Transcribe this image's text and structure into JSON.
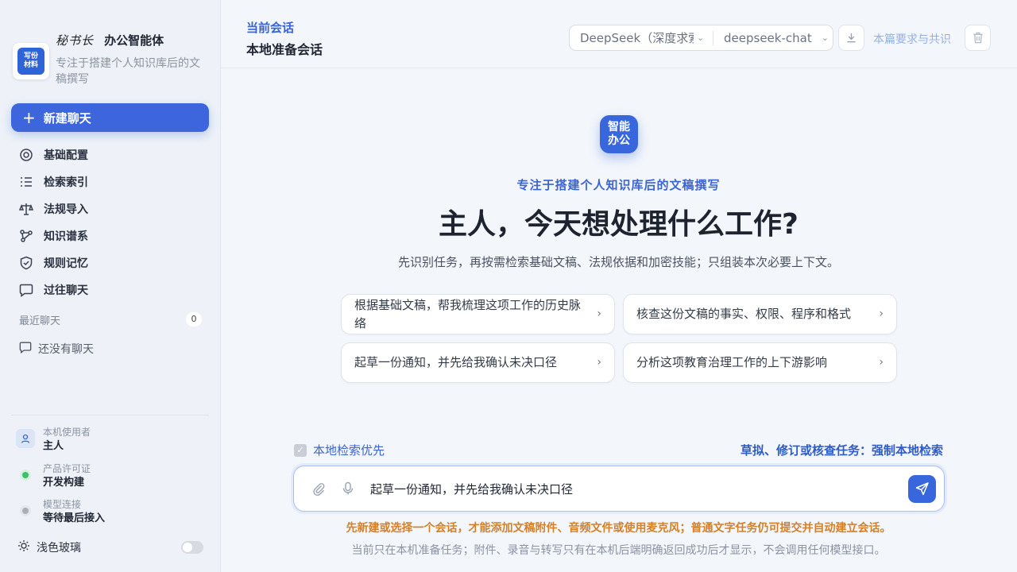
{
  "sidebar": {
    "brand": {
      "signature": "秘书长",
      "name": "办公智能体",
      "logo_text": "写份材料",
      "description": "专注于搭建个人知识库后的文稿撰写"
    },
    "new_chat_label": "新建聊天",
    "nav": [
      {
        "label": "基础配置",
        "icon": "gear-icon"
      },
      {
        "label": "检索索引",
        "icon": "list-icon"
      },
      {
        "label": "法规导入",
        "icon": "scale-icon"
      },
      {
        "label": "知识谱系",
        "icon": "graph-icon"
      },
      {
        "label": "规则记忆",
        "icon": "shield-icon"
      },
      {
        "label": "过往聊天",
        "icon": "chat-icon"
      }
    ],
    "recent": {
      "title": "最近聊天",
      "count": "0",
      "empty_label": "还没有聊天"
    },
    "info": {
      "user_label": "本机使用者",
      "user_value": "主人",
      "license_label": "产品许可证",
      "license_value": "开发构建",
      "model_label": "模型连接",
      "model_value": "等待最后接入"
    },
    "theme_label": "浅色玻璃"
  },
  "header": {
    "current_label": "当前会话",
    "title": "本地准备会话",
    "provider": "DeepSeek（深度求索）",
    "model": "deepseek-chat",
    "consensus_label": "本篇要求与共识"
  },
  "main": {
    "hero_logo": "智能办公",
    "tagline": "专注于搭建个人知识库后的文稿撰写",
    "headline": "主人，今天想处理什么工作?",
    "subline": "先识别任务，再按需检索基础文稿、法规依据和加密技能；只组装本次必要上下文。",
    "suggestions": [
      "根据基础文稿，帮我梳理这项工作的历史脉络",
      "核查这份文稿的事实、权限、程序和格式",
      "起草一份通知，并先给我确认未决口径",
      "分析这项教育治理工作的上下游影响"
    ],
    "local_search_label": "本地检索优先",
    "force_label": "草拟、修订或核查任务：强制本地检索",
    "input_value": "起草一份通知，并先给我确认未决口径",
    "warning": "先新建或选择一个会话，才能添加文稿附件、音频文件或使用麦克风；普通文字任务仍可提交并自动建立会话。",
    "note": "当前只在本机准备任务；附件、录音与转写只有在本机后端明确返回成功后才显示，不会调用任何模型接口。"
  },
  "colors": {
    "accent": "#3766dd",
    "warning": "#d4802b",
    "link": "#3a64d4"
  }
}
